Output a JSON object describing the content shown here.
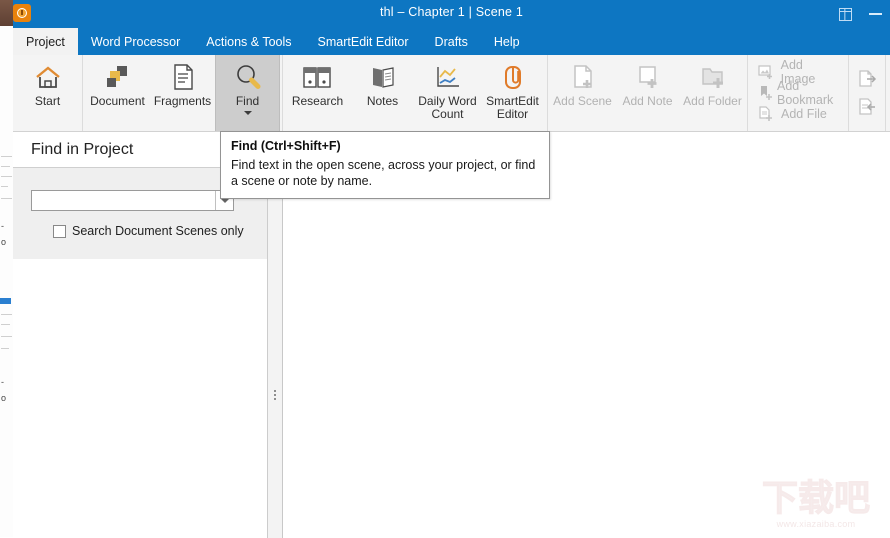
{
  "window": {
    "title": "thl – Chapter 1 | Scene 1",
    "app_icon": "app-logo-icon",
    "panel_toggle_icon": "panel-toggle-icon",
    "minimize_icon": "minimize-icon",
    "accent_color": "#0d76c2",
    "ribbon_bg": "#f4f4f4"
  },
  "tabs": [
    {
      "label": "Project",
      "active": true
    },
    {
      "label": "Word Processor",
      "active": false
    },
    {
      "label": "Actions & Tools",
      "active": false
    },
    {
      "label": "SmartEdit Editor",
      "active": false
    },
    {
      "label": "Drafts",
      "active": false
    },
    {
      "label": "Help",
      "active": false
    }
  ],
  "ribbon": {
    "groups": [
      {
        "name": "navigation",
        "buttons": [
          {
            "label": "Start",
            "icon": "home-icon",
            "state": "normal",
            "caret": false
          }
        ]
      },
      {
        "name": "project-views",
        "buttons": [
          {
            "label": "Document",
            "icon": "document-blocks-icon",
            "state": "normal",
            "caret": false
          },
          {
            "label": "Fragments",
            "icon": "page-lines-icon",
            "state": "normal",
            "caret": false
          },
          {
            "label": "Find",
            "icon": "magnifier-icon",
            "state": "hover",
            "caret": true
          }
        ]
      },
      {
        "name": "research-tools",
        "buttons": [
          {
            "label": "Research",
            "icon": "binders-icon",
            "state": "normal",
            "caret": false
          },
          {
            "label": "Notes",
            "icon": "open-book-icon",
            "state": "normal",
            "caret": false
          },
          {
            "label": "Daily Word Count",
            "icon": "line-chart-icon",
            "state": "normal",
            "caret": false
          },
          {
            "label": "SmartEdit Editor",
            "icon": "paperclip-icon",
            "state": "normal",
            "caret": false
          }
        ]
      },
      {
        "name": "add-items",
        "buttons": [
          {
            "label": "Add Scene",
            "icon": "page-plus-icon",
            "state": "disabled",
            "caret": false
          },
          {
            "label": "Add Note",
            "icon": "note-plus-icon",
            "state": "disabled",
            "caret": false
          },
          {
            "label": "Add Folder",
            "icon": "folder-plus-icon",
            "state": "disabled",
            "caret": false
          }
        ]
      }
    ],
    "small_buttons": [
      {
        "label": "Add Image",
        "icon": "image-plus-icon",
        "state": "disabled"
      },
      {
        "label": "Add Bookmark",
        "icon": "bookmark-plus-icon",
        "state": "disabled"
      },
      {
        "label": "Add File",
        "icon": "file-plus-icon",
        "state": "disabled"
      }
    ],
    "tail_buttons": [
      {
        "label": "",
        "icon": "export-icon",
        "state": "disabled"
      },
      {
        "label": "",
        "icon": "import-icon",
        "state": "disabled"
      }
    ]
  },
  "left_pane": {
    "header_title": "Find in Project",
    "search": {
      "value": "",
      "placeholder": "",
      "dropdown_icon": "chevron-down-icon"
    },
    "checkbox": {
      "label": "Search Document Scenes only",
      "checked": false
    }
  },
  "tooltip": {
    "title": "Find  (Ctrl+Shift+F)",
    "body": "Find text in the open scene, across your project, or find a scene or note by name."
  },
  "watermark": {
    "logo_text": "下载吧",
    "url_text": "www.xiazaiba.com"
  }
}
